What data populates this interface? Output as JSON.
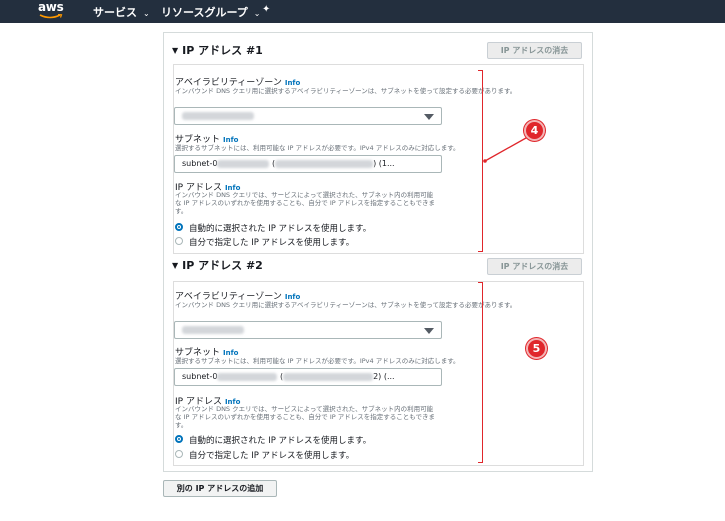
{
  "nav": {
    "logo": "aws",
    "services": "サービス",
    "resource_groups": "リソースグループ",
    "chevron": "⌄",
    "pin": "✦"
  },
  "sections": [
    {
      "title": "IP アドレス #1",
      "clear_label": "IP アドレスの消去",
      "az_label": "アベイラビリティーゾーン",
      "az_desc": "インバウンド DNS クエリ用に選択するアベイラビリティーゾーンは、サブネットを使って設定する必要があります。",
      "subnet_label": "サブネット",
      "subnet_desc": "選択するサブネットには、利用可能な IP アドレスが必要です。IPv4 アドレスのみに対応します。",
      "subnet_value_prefix": "subnet-0",
      "subnet_value_mid": " (",
      "subnet_value_suffix": ") (1...",
      "ip_label": "IP アドレス",
      "ip_desc": "インバウンド DNS クエリでは、サービスによって選択された、サブネット内の利用可能な IP アドレスのいずれかを使用することも、自分で IP アドレスを指定することもできます。",
      "radio_auto": "自動的に選択された IP アドレスを使用します。",
      "radio_manual": "自分で指定した IP アドレスを使用します。",
      "callout": "4"
    },
    {
      "title": "IP アドレス #2",
      "clear_label": "IP アドレスの消去",
      "az_label": "アベイラビリティーゾーン",
      "az_desc": "インバウンド DNS クエリ用に選択するアベイラビリティーゾーンは、サブネットを使って設定する必要があります。",
      "subnet_label": "サブネット",
      "subnet_desc": "選択するサブネットには、利用可能な IP アドレスが必要です。IPv4 アドレスのみに対応します。",
      "subnet_value_prefix": "subnet-0",
      "subnet_value_mid": " (",
      "subnet_value_suffix": "2) (...",
      "ip_label": "IP アドレス",
      "ip_desc": "インバウンド DNS クエリでは、サービスによって選択された、サブネット内の利用可能な IP アドレスのいずれかを使用することも、自分で IP アドレスを指定することもできます。",
      "radio_auto": "自動的に選択された IP アドレスを使用します。",
      "radio_manual": "自分で指定した IP アドレスを使用します。",
      "callout": "5"
    }
  ],
  "info_link": "Info",
  "add_button": "別の IP アドレスの追加",
  "colors": {
    "nav_bg": "#232f3e",
    "accent_blue": "#0073bb",
    "callout_red": "#e0262b"
  }
}
